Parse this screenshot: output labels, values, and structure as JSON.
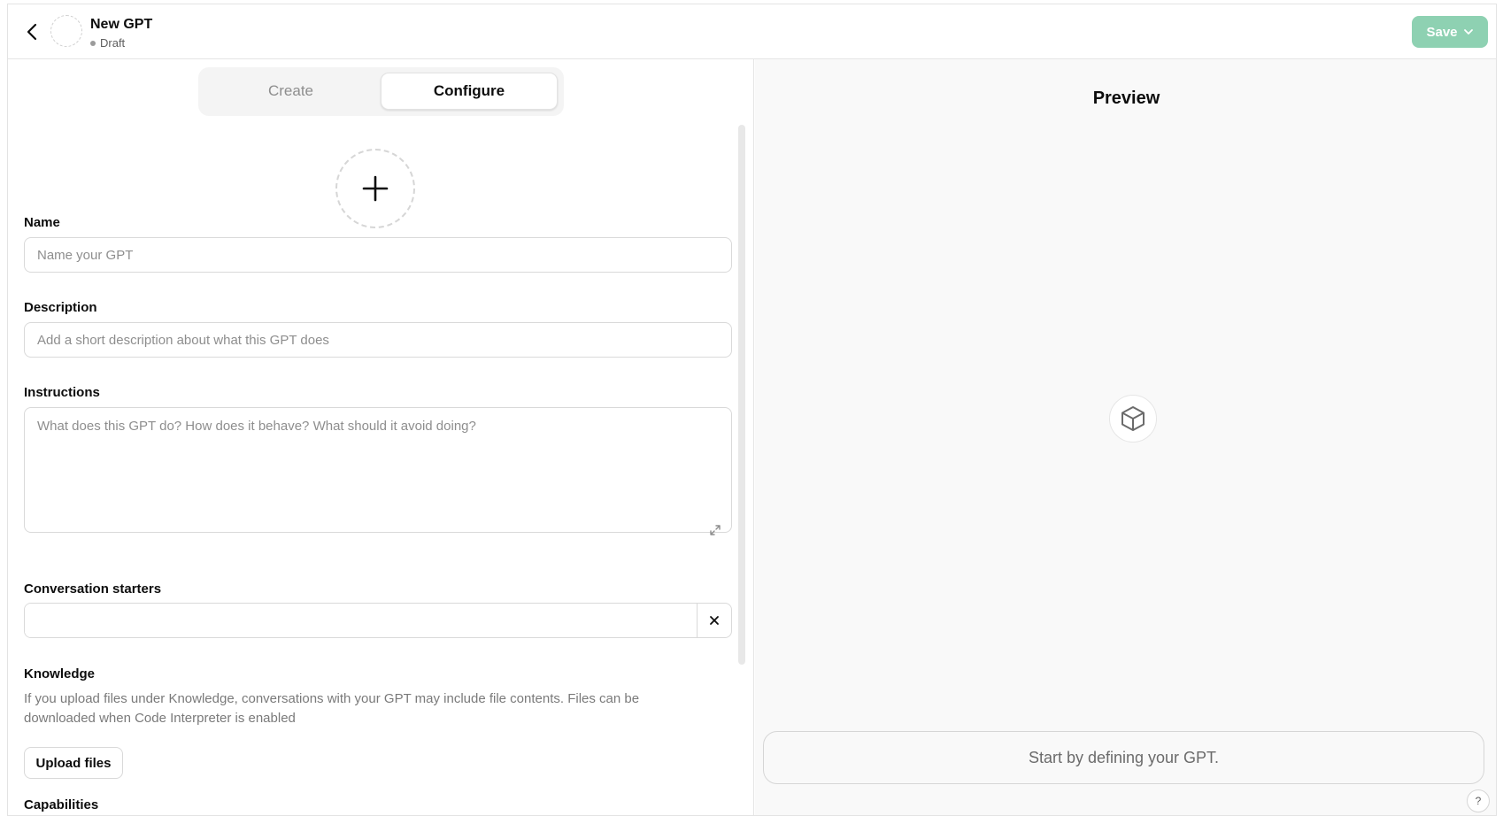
{
  "header": {
    "gpt_name": "New GPT",
    "status": "Draft",
    "save_label": "Save"
  },
  "tabs": [
    {
      "label": "Create",
      "active": false
    },
    {
      "label": "Configure",
      "active": true
    }
  ],
  "form": {
    "name": {
      "label": "Name",
      "placeholder": "Name your GPT",
      "value": ""
    },
    "description": {
      "label": "Description",
      "placeholder": "Add a short description about what this GPT does",
      "value": ""
    },
    "instructions": {
      "label": "Instructions",
      "placeholder": "What does this GPT do? How does it behave? What should it avoid doing?",
      "value": ""
    },
    "conversation_starters": {
      "label": "Conversation starters",
      "value": ""
    },
    "knowledge": {
      "label": "Knowledge",
      "help": "If you upload files under Knowledge, conversations with your GPT may include file contents. Files can be downloaded when Code Interpreter is enabled",
      "upload_label": "Upload files"
    },
    "capabilities": {
      "label": "Capabilities"
    }
  },
  "preview": {
    "title": "Preview",
    "input_placeholder": "Start by defining your GPT.",
    "help_label": "?"
  },
  "icons": [
    "back-arrow-icon",
    "chevron-down-icon",
    "plus-icon",
    "expand-icon",
    "close-icon",
    "cube-icon"
  ],
  "colors": {
    "save_button": "#8ed1b2",
    "preview_bg": "#f9f9f9"
  }
}
